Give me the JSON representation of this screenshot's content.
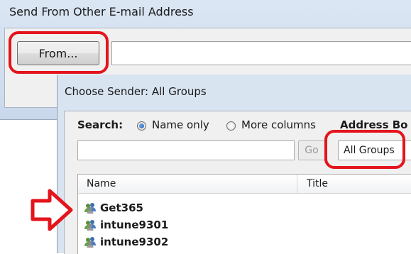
{
  "outer_dialog": {
    "title": "Send From Other E-mail Address",
    "from_button_label": "From...",
    "from_field_value": ""
  },
  "inner_dialog": {
    "title": "Choose Sender: All Groups",
    "search_label": "Search:",
    "radio_name_only": "Name only",
    "radio_more_columns": "More columns",
    "radio_selected": "Name only",
    "address_book_label": "Address Bo",
    "search_input_value": "",
    "go_button_label": "Go",
    "address_book_selected": "All Groups",
    "columns": [
      "Name",
      "Title"
    ],
    "rows": [
      {
        "name": "Get365"
      },
      {
        "name": "intune9301"
      },
      {
        "name": "intune9302"
      }
    ]
  },
  "annotations": {
    "highlight_color": "#e3141b",
    "arrow_icon": "red-arrow-right-icon"
  }
}
